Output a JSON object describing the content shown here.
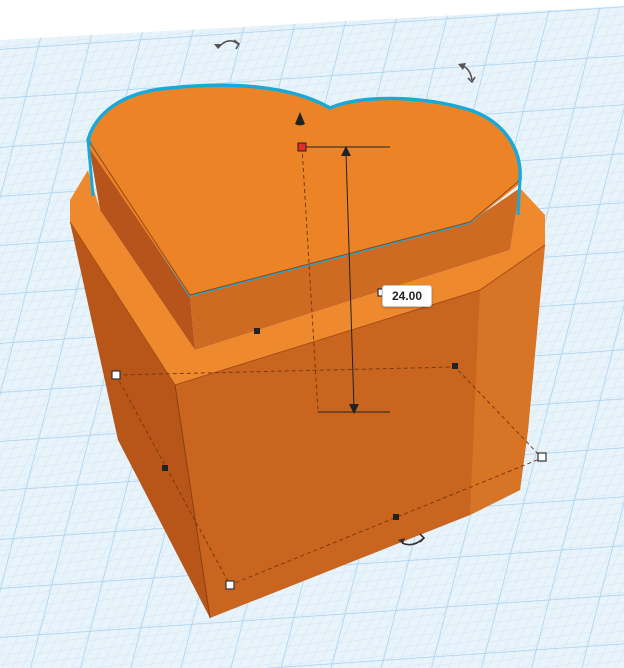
{
  "scene": {
    "shape_name": "heart-box",
    "shape_color": "#ec8427",
    "selection_outline_color": "#1aa9d6",
    "grid_color": "#b9dcf3",
    "handle_color_active": "#e52b2b"
  },
  "dimension": {
    "height_value": "24.00"
  },
  "icons": {
    "rotate_top": "rotate-arrow-icon",
    "rotate_right": "rotate-arrow-icon",
    "rotate_bottom": "rotate-arrow-icon",
    "lift": "cone-arrow-icon"
  }
}
